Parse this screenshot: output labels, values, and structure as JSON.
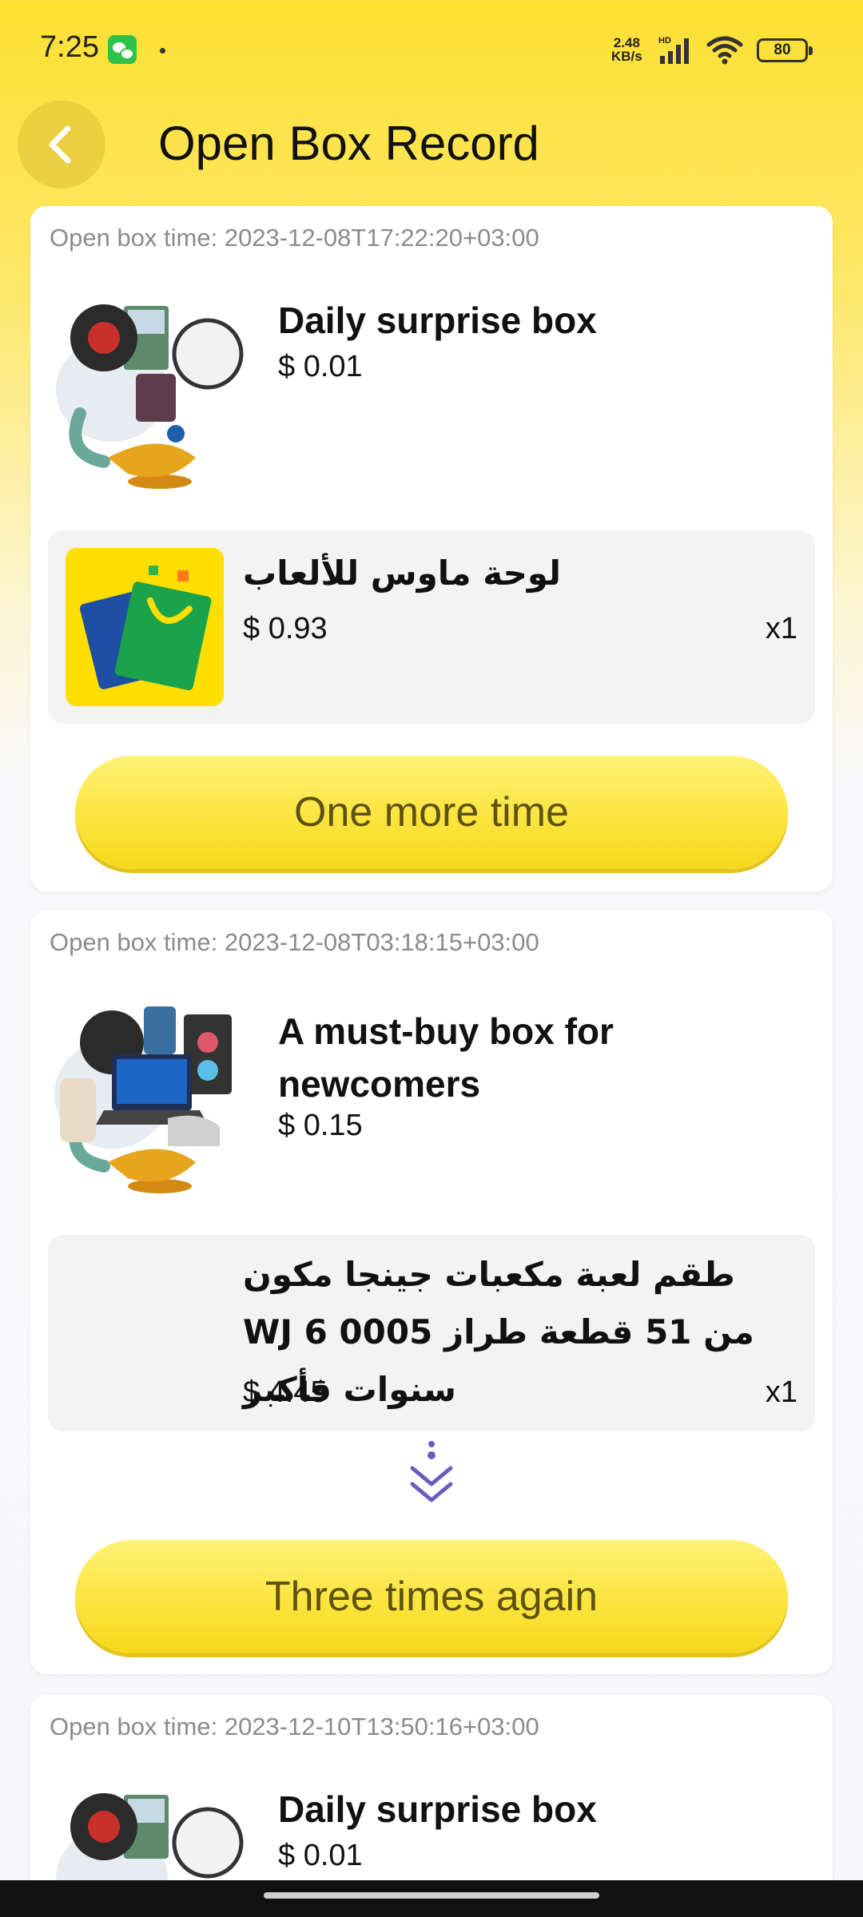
{
  "status_bar": {
    "time": "7:25",
    "net_speed_value": "2.48",
    "net_speed_unit": "KB/s",
    "network_badge": "HD",
    "battery": "80"
  },
  "header": {
    "title": "Open Box Record"
  },
  "records": [
    {
      "open_time": "Open box time: 2023-12-08T17:22:20+03:00",
      "box_name": "Daily surprise box",
      "box_price": "$ 0.01",
      "prize_name": "لوحة ماوس للألعاب",
      "prize_price": "$ 0.93",
      "prize_qty": "x1",
      "action_label": "One more time"
    },
    {
      "open_time": "Open box time: 2023-12-08T03:18:15+03:00",
      "box_name": "A must-buy box for newcomers",
      "box_price": "$ 0.15",
      "prize_name": "طقم لعبة مكعبات جينجا مكون من 51 قطعة طراز WJ 6 0005 سنوات فأكبر",
      "prize_price": "$ 4.45",
      "prize_qty": "x1",
      "action_label": "Three times again"
    },
    {
      "open_time": "Open box time: 2023-12-10T13:50:16+03:00",
      "box_name": "Daily surprise box",
      "box_price": "$ 0.01"
    }
  ],
  "colors": {
    "accent_yellow": "#fbe33a",
    "button_text": "#5d5210",
    "expand_icon": "#6a5bc2"
  },
  "icons": [
    "back-arrow-icon",
    "wechat-icon",
    "signal-icon",
    "wifi-icon",
    "battery-icon",
    "gift-bag-icon",
    "expand-more-icon"
  ]
}
